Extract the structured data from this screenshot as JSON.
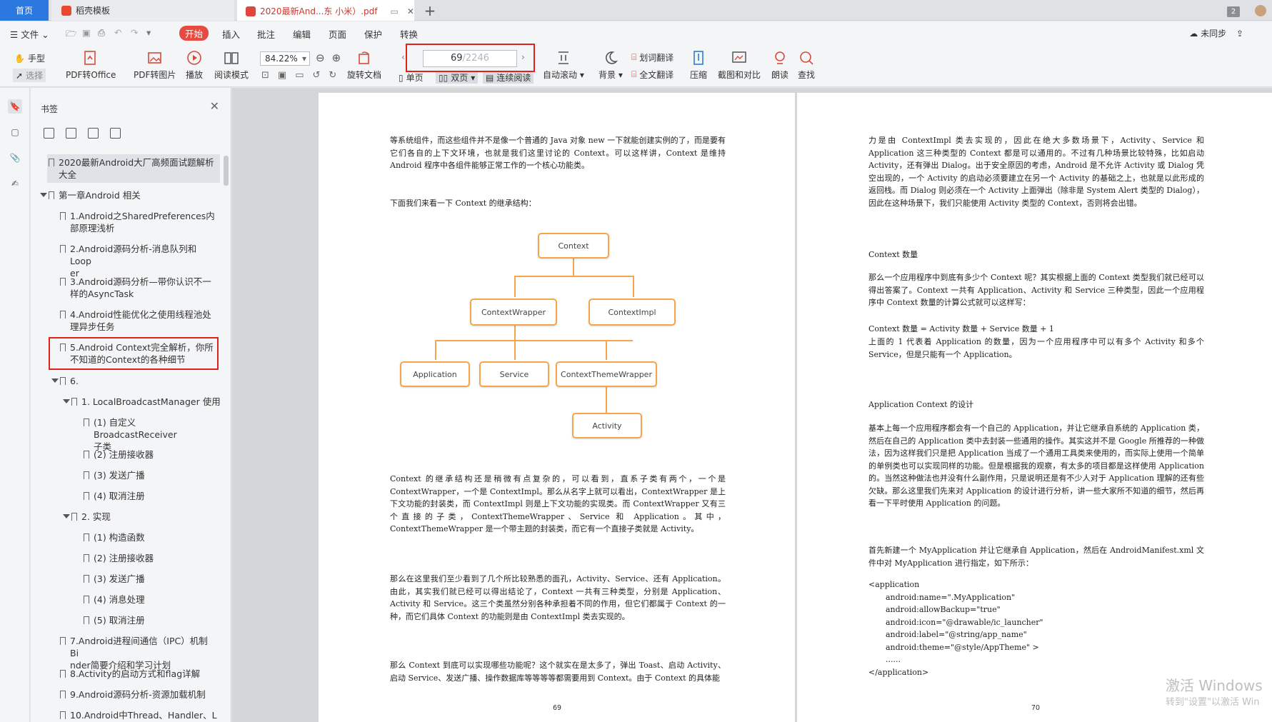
{
  "tabs": {
    "home": "首页",
    "template": "稻壳模板",
    "doc": "2020最新And...东 小米）.pdf",
    "count": "2"
  },
  "menu": {
    "file": "文件",
    "start": "开始",
    "insert": "插入",
    "annotate": "批注",
    "edit": "编辑",
    "page": "页面",
    "protect": "保护",
    "convert": "转换",
    "sync": "未同步"
  },
  "toolbar": {
    "hand": "手型",
    "select": "选择",
    "pdf2office": "PDF转Office",
    "pdf2img": "PDF转图片",
    "play": "播放",
    "readmode": "阅读模式",
    "zoom": "84.22%",
    "rotate": "旋转文档",
    "page_current": "69",
    "page_total": "/2246",
    "single": "单页",
    "double": "双页",
    "continuous": "连续阅读",
    "autoscroll": "自动滚动",
    "background": "背景",
    "word_translate": "划词翻译",
    "full_translate": "全文翻译",
    "compress": "压缩",
    "compare": "截图和对比",
    "read_aloud": "朗读",
    "find": "查找"
  },
  "bookmarks": {
    "title": "书签",
    "items": [
      {
        "text": "2020最新Android大厂高频面试题解析",
        "text2": "大全"
      },
      {
        "text": "第一章Android 相关"
      },
      {
        "text": "1.Android之SharedPreferences内",
        "text2": "部原理浅析"
      },
      {
        "text": "2.Android源码分析-消息队列和Loop",
        "text2": "er"
      },
      {
        "text": "3.Android源码分析—带你认识不一",
        "text2": "样的AsyncTask"
      },
      {
        "text": "4.Android性能优化之使用线程池处",
        "text2": "理异步任务"
      },
      {
        "text": "5.Android Context完全解析，你所",
        "text2": "不知道的Context的各种细节"
      },
      {
        "text": "6."
      },
      {
        "text": "1. LocalBroadcastManager 使用"
      },
      {
        "text": "(1) 自定义 BroadcastReceiver",
        "text2": "子类"
      },
      {
        "text": "(2) 注册接收器"
      },
      {
        "text": "(3) 发送广播"
      },
      {
        "text": "(4) 取消注册"
      },
      {
        "text": "2. 实现"
      },
      {
        "text": "(1) 构造函数"
      },
      {
        "text": "(2) 注册接收器"
      },
      {
        "text": "(3) 发送广播"
      },
      {
        "text": "(4) 消息处理"
      },
      {
        "text": "(5) 取消注册"
      },
      {
        "text": "7.Android进程间通信（IPC）机制Bi",
        "text2": "nder简要介绍和学习计划"
      },
      {
        "text": "8.Activity的启动方式和flag详解"
      },
      {
        "text": "9.Android源码分析-资源加载机制"
      },
      {
        "text": "10.Android中Thread、Handler、L"
      }
    ]
  },
  "page69": {
    "para1": "等系统组件，而这些组件并不是像一个普通的 Java 对象 new 一下就能创建实例的了，而是要有它们各自的上下文环境，也就是我们这里讨论的 Context。可以这样讲，Context 是维持 Android 程序中各组件能够正常工作的一个核心功能类。",
    "para2": "下面我们来看一下 Context 的继承结构：",
    "diagram": {
      "context": "Context",
      "wrapper": "ContextWrapper",
      "impl": "ContextImpl",
      "application": "Application",
      "service": "Service",
      "theme": "ContextThemeWrapper",
      "activity": "Activity"
    },
    "para3": "Context 的继承结构还是稍微有点复杂的，可以看到，直系子类有两个，一个是 ContextWrapper，一个是 ContextImpl。那么从名字上就可以看出，ContextWrapper 是上下文功能的封装类，而 ContextImpl 则是上下文功能的实现类。而 ContextWrapper 又有三个直接的子类，ContextThemeWrapper、Service 和 Application。其中，ContextThemeWrapper 是一个带主题的封装类，而它有一个直接子类就是 Activity。",
    "para4": "那么在这里我们至少看到了几个所比较熟悉的面孔，Activity、Service、还有 Application。由此，其实我们就已经可以得出结论了，Context 一共有三种类型，分别是 Application、Activity 和 Service。这三个类虽然分别各种承担着不同的作用，但它们都属于 Context 的一种，而它们具体 Context 的功能则是由 ContextImpl 类去实现的。",
    "para5": "那么 Context 到底可以实现哪些功能呢？这个就实在是太多了，弹出 Toast、启动 Activity、启动 Service、发送广播、操作数据库等等等等都需要用到 Context。由于 Context 的具体能",
    "number": "69"
  },
  "page70": {
    "para1": "力是由 ContextImpl 类去实现的，因此在绝大多数场景下，Activity、Service 和 Application 这三种类型的 Context 都是可以通用的。不过有几种场景比较特殊，比如启动 Activity，还有弹出 Dialog。出于安全原因的考虑，Android 是不允许 Activity 或 Dialog 凭空出现的，一个 Activity 的启动必须要建立在另一个 Activity 的基础之上，也就是以此形成的返回栈。而 Dialog 则必须在一个 Activity 上面弹出（除非是 System Alert 类型的 Dialog），因此在这种场景下，我们只能使用 Activity 类型的 Context，否则将会出错。",
    "heading1": "Context 数量",
    "para2": "那么一个应用程序中到底有多少个 Context 呢？其实根据上面的 Context 类型我们就已经可以得出答案了。Context 一共有 Application、Activity 和 Service 三种类型，因此一个应用程序中 Context 数量的计算公式就可以这样写：",
    "formula": "Context 数量 = Activity 数量 + Service 数量 + 1",
    "para3": "上面的 1 代表着 Application 的数量，因为一个应用程序中可以有多个 Activity 和多个 Service，但是只能有一个 Application。",
    "heading2": "Application Context 的设计",
    "para4": "基本上每一个应用程序都会有一个自己的 Application，并让它继承自系统的 Application 类，然后在自己的 Application 类中去封装一些通用的操作。其实这并不是 Google 所推荐的一种做法，因为这样我们只是把 Application 当成了一个通用工具类来使用的，而实际上使用一个简单的单例类也可以实现同样的功能。但是根据我的观察，有太多的项目都是这样使用 Application 的。当然这种做法也并没有什么副作用，只是说明还是有不少人对于 Application 理解的还有些欠缺。那么这里我们先来对 Application 的设计进行分析，讲一些大家所不知道的细节，然后再看一下平时使用 Application 的问题。",
    "para5": "首先新建一个 MyApplication 并让它继承自 Application，然后在 AndroidManifest.xml 文件中对 MyApplication 进行指定，如下所示：",
    "code": [
      "<application",
      "android:name=\".MyApplication\"",
      "android:allowBackup=\"true\"",
      "android:icon=\"@drawable/ic_launcher\"",
      "android:label=\"@string/app_name\"",
      "android:theme=\"@style/AppTheme\" >",
      "......",
      "</application>"
    ],
    "number": "70"
  },
  "watermark": {
    "line1": "激活 Windows",
    "line2": "转到\"设置\"以激活 Win"
  }
}
